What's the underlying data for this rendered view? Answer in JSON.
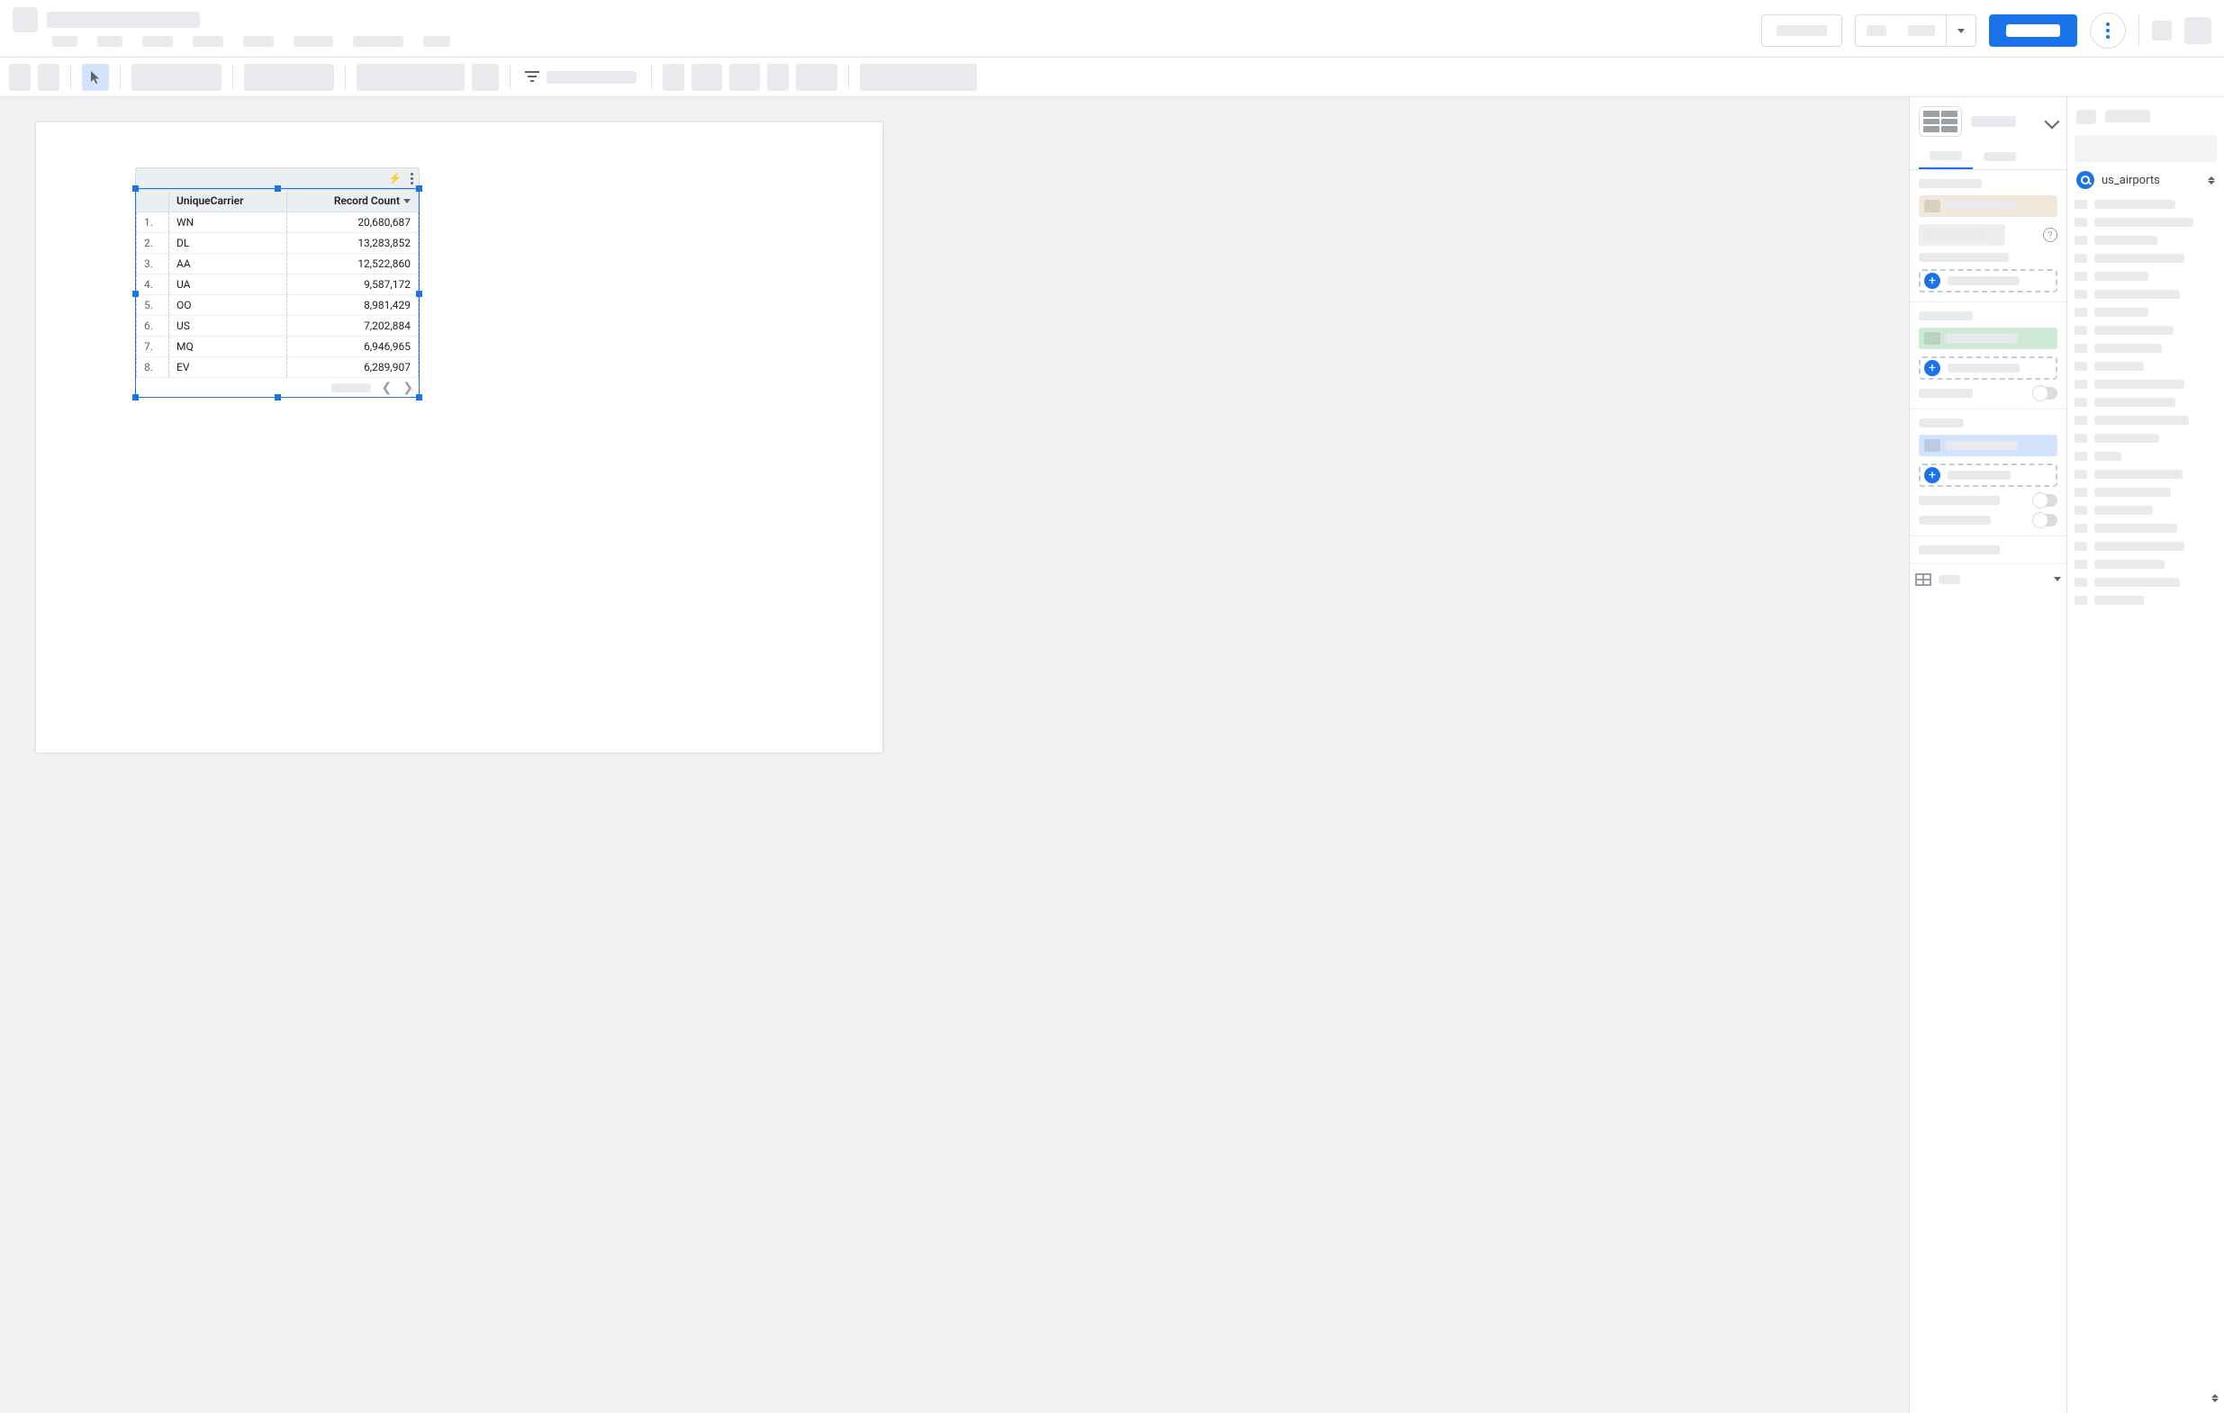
{
  "data_source": {
    "name": "us_airports"
  },
  "table": {
    "columns": [
      "UniqueCarrier",
      "Record Count"
    ],
    "rows": [
      {
        "idx": "1.",
        "carrier": "WN",
        "count": "20,680,687"
      },
      {
        "idx": "2.",
        "carrier": "DL",
        "count": "13,283,852"
      },
      {
        "idx": "3.",
        "carrier": "AA",
        "count": "12,522,860"
      },
      {
        "idx": "4.",
        "carrier": "UA",
        "count": "9,587,172"
      },
      {
        "idx": "5.",
        "carrier": "OO",
        "count": "8,981,429"
      },
      {
        "idx": "6.",
        "carrier": "US",
        "count": "7,202,884"
      },
      {
        "idx": "7.",
        "carrier": "MQ",
        "count": "6,946,965"
      },
      {
        "idx": "8.",
        "carrier": "EV",
        "count": "6,289,907"
      }
    ]
  }
}
